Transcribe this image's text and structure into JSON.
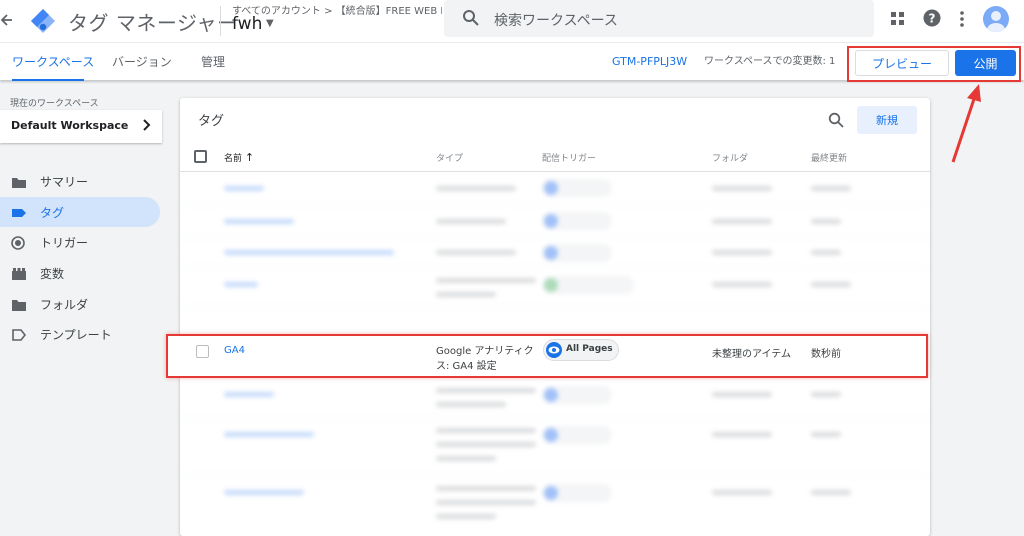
{
  "header": {
    "app_title": "タグ マネージャー",
    "account_breadcrumb": "すべてのアカウント > 【統合版】FREE WEB H...",
    "container_name": "fwh",
    "search_placeholder": "検索ワークスペース",
    "icons": [
      "back-arrow-icon",
      "gtm-logo-icon",
      "search-icon",
      "apps-grid-icon",
      "help-icon",
      "more-vert-icon",
      "account-avatar-icon"
    ]
  },
  "subheader": {
    "tabs": [
      {
        "label": "ワークスペース",
        "active": true
      },
      {
        "label": "バージョン",
        "active": false
      },
      {
        "label": "管理",
        "active": false
      }
    ],
    "container_id": "GTM-PFPLJ3W",
    "workspace_changes": "ワークスペースでの変更数: 1",
    "preview_label": "プレビュー",
    "publish_label": "公開"
  },
  "sidebar": {
    "current_workspace_label": "現在のワークスペース",
    "workspace_name": "Default Workspace",
    "items": [
      {
        "label": "サマリー",
        "icon": "summary-icon",
        "active": false
      },
      {
        "label": "タグ",
        "icon": "tag-icon",
        "active": true
      },
      {
        "label": "トリガー",
        "icon": "trigger-icon",
        "active": false
      },
      {
        "label": "変数",
        "icon": "variables-icon",
        "active": false
      },
      {
        "label": "フォルダ",
        "icon": "folder-icon",
        "active": false
      },
      {
        "label": "テンプレート",
        "icon": "template-icon",
        "active": false
      }
    ]
  },
  "tags_card": {
    "title": "タグ",
    "new_label": "新規",
    "columns": [
      "名前",
      "タイプ",
      "配信トリガー",
      "フォルダ",
      "最終更新"
    ],
    "sort_indicator": "↑",
    "highlighted_row": {
      "name": "GA4",
      "type": "Google アナリティクス: GA4 設定",
      "trigger": "All Pages",
      "folder": "未整理のアイテム",
      "last_updated": "数秒前"
    }
  },
  "colors": {
    "accent": "#1a73e8",
    "highlight_red": "#e53935",
    "sidebar_active": "#d2e3fc"
  }
}
